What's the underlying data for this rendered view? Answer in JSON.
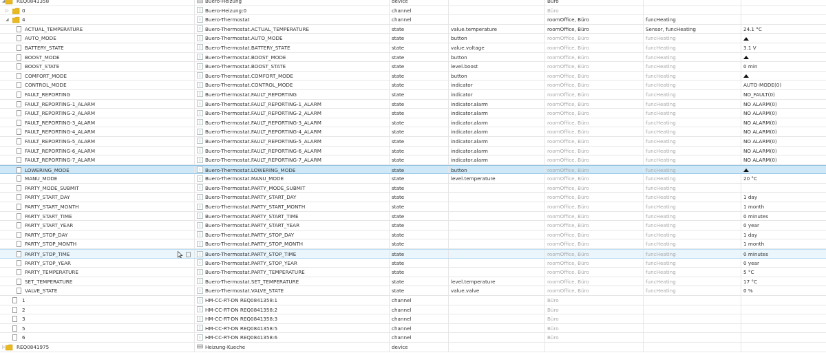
{
  "rows": [
    {
      "id": "REQ0841358",
      "twisty": "expanded",
      "depth": 0,
      "icon": "folder-icon",
      "name": "Buero-Heizung",
      "name_icon": "device-icon",
      "type": "device",
      "role": "",
      "rooms": "Büro",
      "rooms_muted": false,
      "funcs": "",
      "funcs_muted": false,
      "value": "",
      "value_kind": "text"
    },
    {
      "id": "0",
      "twisty": "collapsed",
      "depth": 1,
      "icon": "folder-icon",
      "name": "Buero-Heizung:0",
      "name_icon": "channel-icon",
      "type": "channel",
      "role": "",
      "rooms": "Büro",
      "rooms_muted": true,
      "funcs": "",
      "funcs_muted": false,
      "value": "",
      "value_kind": "text"
    },
    {
      "id": "4",
      "twisty": "expanded",
      "depth": 1,
      "icon": "folder-icon",
      "name": "Buero-Thermostat",
      "name_icon": "channel-icon",
      "type": "channel",
      "role": "",
      "rooms": "roomOffice, Büro",
      "rooms_muted": false,
      "funcs": "funcHeating",
      "funcs_muted": false,
      "value": "",
      "value_kind": "text"
    },
    {
      "id": "ACTUAL_TEMPERATURE",
      "twisty": "none",
      "depth": 2,
      "icon": "file-icon",
      "name": "Buero-Thermostat.ACTUAL_TEMPERATURE",
      "name_icon": "state-icon",
      "type": "state",
      "role": "value.temperature",
      "rooms": "roomOffice, Büro",
      "rooms_muted": false,
      "funcs": "Sensor, funcHeating",
      "funcs_muted": false,
      "value": "24.1 °C",
      "value_kind": "text"
    },
    {
      "id": "AUTO_MODE",
      "twisty": "none",
      "depth": 2,
      "icon": "file-icon",
      "name": "Buero-Thermostat.AUTO_MODE",
      "name_icon": "state-icon",
      "type": "state",
      "role": "button",
      "rooms": "roomOffice, Büro",
      "rooms_muted": true,
      "funcs": "funcHeating",
      "funcs_muted": true,
      "value": "",
      "value_kind": "button"
    },
    {
      "id": "BATTERY_STATE",
      "twisty": "none",
      "depth": 2,
      "icon": "file-icon",
      "name": "Buero-Thermostat.BATTERY_STATE",
      "name_icon": "state-icon",
      "type": "state",
      "role": "value.voltage",
      "rooms": "roomOffice, Büro",
      "rooms_muted": true,
      "funcs": "funcHeating",
      "funcs_muted": true,
      "value": "3.1 V",
      "value_kind": "text"
    },
    {
      "id": "BOOST_MODE",
      "twisty": "none",
      "depth": 2,
      "icon": "file-icon",
      "name": "Buero-Thermostat.BOOST_MODE",
      "name_icon": "state-icon",
      "type": "state",
      "role": "button",
      "rooms": "roomOffice, Büro",
      "rooms_muted": true,
      "funcs": "funcHeating",
      "funcs_muted": true,
      "value": "",
      "value_kind": "button"
    },
    {
      "id": "BOOST_STATE",
      "twisty": "none",
      "depth": 2,
      "icon": "file-icon",
      "name": "Buero-Thermostat.BOOST_STATE",
      "name_icon": "state-icon",
      "type": "state",
      "role": "level.boost",
      "rooms": "roomOffice, Büro",
      "rooms_muted": true,
      "funcs": "funcHeating",
      "funcs_muted": true,
      "value": "0 min",
      "value_kind": "text"
    },
    {
      "id": "COMFORT_MODE",
      "twisty": "none",
      "depth": 2,
      "icon": "file-icon",
      "name": "Buero-Thermostat.COMFORT_MODE",
      "name_icon": "state-icon",
      "type": "state",
      "role": "button",
      "rooms": "roomOffice, Büro",
      "rooms_muted": true,
      "funcs": "funcHeating",
      "funcs_muted": true,
      "value": "",
      "value_kind": "button"
    },
    {
      "id": "CONTROL_MODE",
      "twisty": "none",
      "depth": 2,
      "icon": "file-icon",
      "name": "Buero-Thermostat.CONTROL_MODE",
      "name_icon": "state-icon",
      "type": "state",
      "role": "indicator",
      "rooms": "roomOffice, Büro",
      "rooms_muted": true,
      "funcs": "funcHeating",
      "funcs_muted": true,
      "value": "AUTO-MODE(0)",
      "value_kind": "text"
    },
    {
      "id": "FAULT_REPORTING",
      "twisty": "none",
      "depth": 2,
      "icon": "file-icon",
      "name": "Buero-Thermostat.FAULT_REPORTING",
      "name_icon": "state-icon",
      "type": "state",
      "role": "indicator",
      "rooms": "roomOffice, Büro",
      "rooms_muted": true,
      "funcs": "funcHeating",
      "funcs_muted": true,
      "value": "NO_FAULT(0)",
      "value_kind": "text"
    },
    {
      "id": "FAULT_REPORTING-1_ALARM",
      "twisty": "none",
      "depth": 2,
      "icon": "file-icon",
      "name": "Buero-Thermostat.FAULT_REPORTING-1_ALARM",
      "name_icon": "state-icon",
      "type": "state",
      "role": "indicator.alarm",
      "rooms": "roomOffice, Büro",
      "rooms_muted": true,
      "funcs": "funcHeating",
      "funcs_muted": true,
      "value": "NO ALARM(0)",
      "value_kind": "text"
    },
    {
      "id": "FAULT_REPORTING-2_ALARM",
      "twisty": "none",
      "depth": 2,
      "icon": "file-icon",
      "name": "Buero-Thermostat.FAULT_REPORTING-2_ALARM",
      "name_icon": "state-icon",
      "type": "state",
      "role": "indicator.alarm",
      "rooms": "roomOffice, Büro",
      "rooms_muted": true,
      "funcs": "funcHeating",
      "funcs_muted": true,
      "value": "NO ALARM(0)",
      "value_kind": "text"
    },
    {
      "id": "FAULT_REPORTING-3_ALARM",
      "twisty": "none",
      "depth": 2,
      "icon": "file-icon",
      "name": "Buero-Thermostat.FAULT_REPORTING-3_ALARM",
      "name_icon": "state-icon",
      "type": "state",
      "role": "indicator.alarm",
      "rooms": "roomOffice, Büro",
      "rooms_muted": true,
      "funcs": "funcHeating",
      "funcs_muted": true,
      "value": "NO ALARM(0)",
      "value_kind": "text"
    },
    {
      "id": "FAULT_REPORTING-4_ALARM",
      "twisty": "none",
      "depth": 2,
      "icon": "file-icon",
      "name": "Buero-Thermostat.FAULT_REPORTING-4_ALARM",
      "name_icon": "state-icon",
      "type": "state",
      "role": "indicator.alarm",
      "rooms": "roomOffice, Büro",
      "rooms_muted": true,
      "funcs": "funcHeating",
      "funcs_muted": true,
      "value": "NO ALARM(0)",
      "value_kind": "text"
    },
    {
      "id": "FAULT_REPORTING-5_ALARM",
      "twisty": "none",
      "depth": 2,
      "icon": "file-icon",
      "name": "Buero-Thermostat.FAULT_REPORTING-5_ALARM",
      "name_icon": "state-icon",
      "type": "state",
      "role": "indicator.alarm",
      "rooms": "roomOffice, Büro",
      "rooms_muted": true,
      "funcs": "funcHeating",
      "funcs_muted": true,
      "value": "NO ALARM(0)",
      "value_kind": "text"
    },
    {
      "id": "FAULT_REPORTING-6_ALARM",
      "twisty": "none",
      "depth": 2,
      "icon": "file-icon",
      "name": "Buero-Thermostat.FAULT_REPORTING-6_ALARM",
      "name_icon": "state-icon",
      "type": "state",
      "role": "indicator.alarm",
      "rooms": "roomOffice, Büro",
      "rooms_muted": true,
      "funcs": "funcHeating",
      "funcs_muted": true,
      "value": "NO ALARM(0)",
      "value_kind": "text"
    },
    {
      "id": "FAULT_REPORTING-7_ALARM",
      "twisty": "none",
      "depth": 2,
      "icon": "file-icon",
      "name": "Buero-Thermostat.FAULT_REPORTING-7_ALARM",
      "name_icon": "state-icon",
      "type": "state",
      "role": "indicator.alarm",
      "rooms": "roomOffice, Büro",
      "rooms_muted": true,
      "funcs": "funcHeating",
      "funcs_muted": true,
      "value": "NO ALARM(0)",
      "value_kind": "text"
    },
    {
      "id": "LOWERING_MODE",
      "twisty": "none",
      "depth": 2,
      "icon": "file-icon",
      "name": "Buero-Thermostat.LOWERING_MODE",
      "name_icon": "state-icon",
      "type": "state",
      "role": "button",
      "rooms": "roomOffice, Büro",
      "rooms_muted": true,
      "funcs": "funcHeating",
      "funcs_muted": true,
      "value": "",
      "value_kind": "button",
      "state": "selected"
    },
    {
      "id": "MANU_MODE",
      "twisty": "none",
      "depth": 2,
      "icon": "file-icon",
      "name": "Buero-Thermostat.MANU_MODE",
      "name_icon": "state-icon",
      "type": "state",
      "role": "level.temperature",
      "rooms": "roomOffice, Büro",
      "rooms_muted": true,
      "funcs": "funcHeating",
      "funcs_muted": true,
      "value": "20 °C",
      "value_kind": "text"
    },
    {
      "id": "PARTY_MODE_SUBMIT",
      "twisty": "none",
      "depth": 2,
      "icon": "file-icon",
      "name": "Buero-Thermostat.PARTY_MODE_SUBMIT",
      "name_icon": "state-icon",
      "type": "state",
      "role": "",
      "rooms": "roomOffice, Büro",
      "rooms_muted": true,
      "funcs": "funcHeating",
      "funcs_muted": true,
      "value": "",
      "value_kind": "text"
    },
    {
      "id": "PARTY_START_DAY",
      "twisty": "none",
      "depth": 2,
      "icon": "file-icon",
      "name": "Buero-Thermostat.PARTY_START_DAY",
      "name_icon": "state-icon",
      "type": "state",
      "role": "",
      "rooms": "roomOffice, Büro",
      "rooms_muted": true,
      "funcs": "funcHeating",
      "funcs_muted": true,
      "value": "1 day",
      "value_kind": "text"
    },
    {
      "id": "PARTY_START_MONTH",
      "twisty": "none",
      "depth": 2,
      "icon": "file-icon",
      "name": "Buero-Thermostat.PARTY_START_MONTH",
      "name_icon": "state-icon",
      "type": "state",
      "role": "",
      "rooms": "roomOffice, Büro",
      "rooms_muted": true,
      "funcs": "funcHeating",
      "funcs_muted": true,
      "value": "1 month",
      "value_kind": "text"
    },
    {
      "id": "PARTY_START_TIME",
      "twisty": "none",
      "depth": 2,
      "icon": "file-icon",
      "name": "Buero-Thermostat.PARTY_START_TIME",
      "name_icon": "state-icon",
      "type": "state",
      "role": "",
      "rooms": "roomOffice, Büro",
      "rooms_muted": true,
      "funcs": "funcHeating",
      "funcs_muted": true,
      "value": "0 minutes",
      "value_kind": "text"
    },
    {
      "id": "PARTY_START_YEAR",
      "twisty": "none",
      "depth": 2,
      "icon": "file-icon",
      "name": "Buero-Thermostat.PARTY_START_YEAR",
      "name_icon": "state-icon",
      "type": "state",
      "role": "",
      "rooms": "roomOffice, Büro",
      "rooms_muted": true,
      "funcs": "funcHeating",
      "funcs_muted": true,
      "value": "0 year",
      "value_kind": "text"
    },
    {
      "id": "PARTY_STOP_DAY",
      "twisty": "none",
      "depth": 2,
      "icon": "file-icon",
      "name": "Buero-Thermostat.PARTY_STOP_DAY",
      "name_icon": "state-icon",
      "type": "state",
      "role": "",
      "rooms": "roomOffice, Büro",
      "rooms_muted": true,
      "funcs": "funcHeating",
      "funcs_muted": true,
      "value": "1 day",
      "value_kind": "text"
    },
    {
      "id": "PARTY_STOP_MONTH",
      "twisty": "none",
      "depth": 2,
      "icon": "file-icon",
      "name": "Buero-Thermostat.PARTY_STOP_MONTH",
      "name_icon": "state-icon",
      "type": "state",
      "role": "",
      "rooms": "roomOffice, Büro",
      "rooms_muted": true,
      "funcs": "funcHeating",
      "funcs_muted": true,
      "value": "1 month",
      "value_kind": "text"
    },
    {
      "id": "PARTY_STOP_TIME",
      "twisty": "none",
      "depth": 2,
      "icon": "file-icon",
      "name": "Buero-Thermostat.PARTY_STOP_TIME",
      "name_icon": "state-icon",
      "type": "state",
      "role": "",
      "rooms": "roomOffice, Büro",
      "rooms_muted": true,
      "funcs": "funcHeating",
      "funcs_muted": true,
      "value": "0 minutes",
      "value_kind": "text",
      "state": "hovered"
    },
    {
      "id": "PARTY_STOP_YEAR",
      "twisty": "none",
      "depth": 2,
      "icon": "file-icon",
      "name": "Buero-Thermostat.PARTY_STOP_YEAR",
      "name_icon": "state-icon",
      "type": "state",
      "role": "",
      "rooms": "roomOffice, Büro",
      "rooms_muted": true,
      "funcs": "funcHeating",
      "funcs_muted": true,
      "value": "0 year",
      "value_kind": "text"
    },
    {
      "id": "PARTY_TEMPERATURE",
      "twisty": "none",
      "depth": 2,
      "icon": "file-icon",
      "name": "Buero-Thermostat.PARTY_TEMPERATURE",
      "name_icon": "state-icon",
      "type": "state",
      "role": "",
      "rooms": "roomOffice, Büro",
      "rooms_muted": true,
      "funcs": "funcHeating",
      "funcs_muted": true,
      "value": "5 °C",
      "value_kind": "text"
    },
    {
      "id": "SET_TEMPERATURE",
      "twisty": "none",
      "depth": 2,
      "icon": "file-icon",
      "name": "Buero-Thermostat.SET_TEMPERATURE",
      "name_icon": "state-icon",
      "type": "state",
      "role": "level.temperature",
      "rooms": "roomOffice, Büro",
      "rooms_muted": true,
      "funcs": "funcHeating",
      "funcs_muted": true,
      "value": "17 °C",
      "value_kind": "text"
    },
    {
      "id": "VALVE_STATE",
      "twisty": "none",
      "depth": 2,
      "icon": "file-icon",
      "name": "Buero-Thermostat.VALVE_STATE",
      "name_icon": "state-icon",
      "type": "state",
      "role": "value.valve",
      "rooms": "roomOffice, Büro",
      "rooms_muted": true,
      "funcs": "funcHeating",
      "funcs_muted": true,
      "value": "0 %",
      "value_kind": "text"
    },
    {
      "id": "1",
      "twisty": "none",
      "depth": 1,
      "icon": "file-icon",
      "name": "HM-CC-RT-DN REQ0841358:1",
      "name_icon": "channel-icon",
      "type": "channel",
      "role": "",
      "rooms": "Büro",
      "rooms_muted": true,
      "funcs": "",
      "funcs_muted": false,
      "value": "",
      "value_kind": "text"
    },
    {
      "id": "2",
      "twisty": "none",
      "depth": 1,
      "icon": "file-icon",
      "name": "HM-CC-RT-DN REQ0841358:2",
      "name_icon": "channel-icon",
      "type": "channel",
      "role": "",
      "rooms": "Büro",
      "rooms_muted": true,
      "funcs": "",
      "funcs_muted": false,
      "value": "",
      "value_kind": "text"
    },
    {
      "id": "3",
      "twisty": "none",
      "depth": 1,
      "icon": "file-icon",
      "name": "HM-CC-RT-DN REQ0841358:3",
      "name_icon": "channel-icon",
      "type": "channel",
      "role": "",
      "rooms": "Büro",
      "rooms_muted": true,
      "funcs": "",
      "funcs_muted": false,
      "value": "",
      "value_kind": "text"
    },
    {
      "id": "5",
      "twisty": "none",
      "depth": 1,
      "icon": "file-icon",
      "name": "HM-CC-RT-DN REQ0841358:5",
      "name_icon": "channel-icon",
      "type": "channel",
      "role": "",
      "rooms": "Büro",
      "rooms_muted": true,
      "funcs": "",
      "funcs_muted": false,
      "value": "",
      "value_kind": "text"
    },
    {
      "id": "6",
      "twisty": "none",
      "depth": 1,
      "icon": "file-icon",
      "name": "HM-CC-RT-DN REQ0841358:6",
      "name_icon": "channel-icon",
      "type": "channel",
      "role": "",
      "rooms": "Büro",
      "rooms_muted": true,
      "funcs": "",
      "funcs_muted": false,
      "value": "",
      "value_kind": "text"
    },
    {
      "id": "REQ0841975",
      "twisty": "collapsed",
      "depth": 0,
      "icon": "folder-icon",
      "name": "Heizung-Kueche",
      "name_icon": "device-icon",
      "type": "device",
      "role": "",
      "rooms": "",
      "rooms_muted": false,
      "funcs": "",
      "funcs_muted": false,
      "value": "",
      "value_kind": "text"
    }
  ],
  "colors": {
    "folder": "#e8b923",
    "grid_line": "#e6e6e6",
    "selected_bg": "#cfe8f7",
    "hover_bg": "#eaf5fc",
    "muted_text": "#a9a9a9"
  }
}
